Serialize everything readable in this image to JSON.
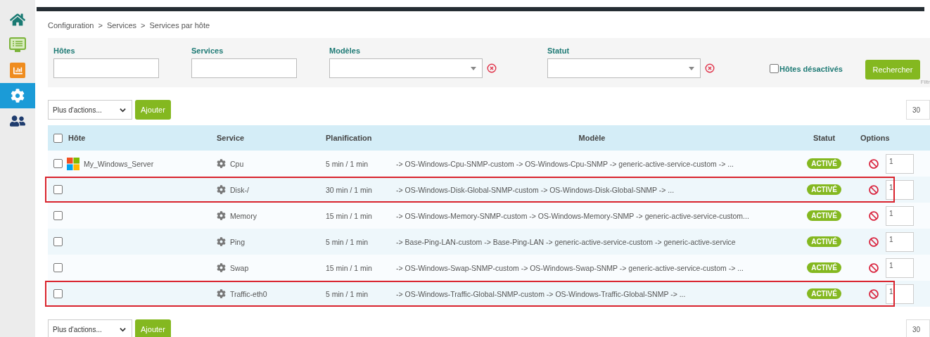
{
  "nav": [
    {
      "kind": "home",
      "selected": false
    },
    {
      "kind": "monitoring",
      "selected": false
    },
    {
      "kind": "reporting",
      "selected": false
    },
    {
      "kind": "configuration",
      "selected": true
    },
    {
      "kind": "administration",
      "selected": false
    }
  ],
  "breadcrumb": [
    "Configuration",
    ">",
    "Services",
    ">",
    "Services par hôte"
  ],
  "filters": [
    {
      "kind": "text",
      "label": "Hôtes"
    },
    {
      "kind": "text",
      "label": "Services"
    },
    {
      "kind": "select",
      "label": "Modèles"
    },
    {
      "kind": "select",
      "label": "Statut"
    }
  ],
  "disabled_hosts": {
    "label": "Hôtes désactivés",
    "checked": false
  },
  "search_button": "Rechercher",
  "filter_hint": "Filtr",
  "actions_top": {
    "select": "Plus d'actions...",
    "button": "Ajouter",
    "page_size": "30"
  },
  "table": {
    "select_all_checked": false,
    "columns": [
      "Hôte",
      "Service",
      "Planification",
      "Modèle",
      "Statut",
      "Options"
    ],
    "rows": [
      {
        "host": "My_Windows_Server",
        "service": "Cpu",
        "schedule": "5 min / 1 min",
        "template": "-> OS-Windows-Cpu-SNMP-custom -> OS-Windows-Cpu-SNMP -> generic-active-service-custom -> ...",
        "status": "ACTIVÉ",
        "option": "1",
        "checked": false,
        "highlighted": false
      },
      {
        "service": "Disk-/",
        "schedule": "30 min / 1 min",
        "template": "-> OS-Windows-Disk-Global-SNMP-custom -> OS-Windows-Disk-Global-SNMP -> ...",
        "status": "ACTIVÉ",
        "option": "1",
        "checked": false,
        "highlighted": true
      },
      {
        "service": "Memory",
        "schedule": "15 min / 1 min",
        "template": "-> OS-Windows-Memory-SNMP-custom -> OS-Windows-Memory-SNMP -> generic-active-service-custom...",
        "status": "ACTIVÉ",
        "option": "1",
        "checked": false,
        "highlighted": false
      },
      {
        "service": "Ping",
        "schedule": "5 min / 1 min",
        "template": "-> Base-Ping-LAN-custom -> Base-Ping-LAN -> generic-active-service-custom -> generic-active-service",
        "status": "ACTIVÉ",
        "option": "1",
        "checked": false,
        "highlighted": false
      },
      {
        "service": "Swap",
        "schedule": "15 min / 1 min",
        "template": "-> OS-Windows-Swap-SNMP-custom -> OS-Windows-Swap-SNMP -> generic-active-service-custom -> ...",
        "status": "ACTIVÉ",
        "option": "1",
        "checked": false,
        "highlighted": false
      },
      {
        "service": "Traffic-eth0",
        "schedule": "5 min / 1 min",
        "template": "-> OS-Windows-Traffic-Global-SNMP-custom -> OS-Windows-Traffic-Global-SNMP -> ...",
        "status": "ACTIVÉ",
        "option": "1",
        "checked": false,
        "highlighted": true
      }
    ]
  },
  "actions_bottom": {
    "select": "Plus d'actions...",
    "button": "Ajouter",
    "page_size": "30"
  }
}
